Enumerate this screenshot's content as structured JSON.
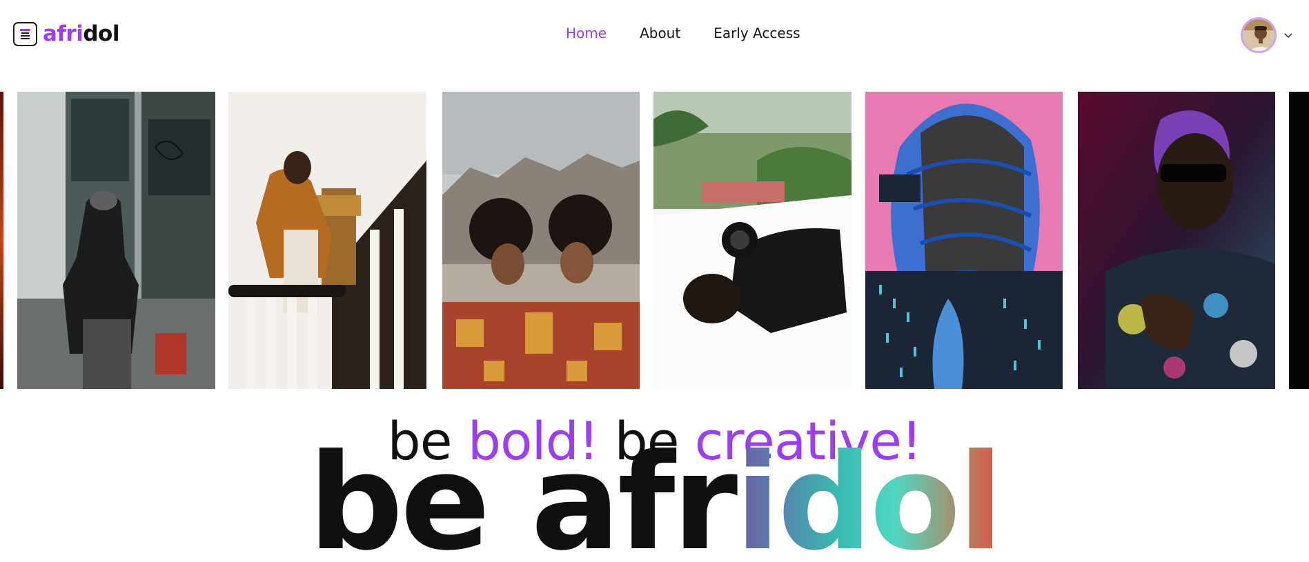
{
  "brand": {
    "name_part1": "afri",
    "name_part2": "dol",
    "accent_color": "#9b3ef2",
    "logo_icon": "book-stack-icon"
  },
  "nav": {
    "items": [
      {
        "label": "Home",
        "active": true
      },
      {
        "label": "About",
        "active": false
      },
      {
        "label": "Early Access",
        "active": false
      }
    ]
  },
  "account": {
    "avatar_icon": "user-avatar",
    "menu_icon": "chevron-down-icon"
  },
  "gallery": {
    "photos": [
      {
        "name": "photo-red-edge"
      },
      {
        "name": "photo-hoodie-graffiti"
      },
      {
        "name": "photo-staircase-jacket"
      },
      {
        "name": "photo-twins-blanket"
      },
      {
        "name": "photo-lying-white"
      },
      {
        "name": "photo-painted-portrait"
      },
      {
        "name": "photo-neon-portrait"
      },
      {
        "name": "photo-dark-edge"
      }
    ]
  },
  "hero": {
    "tagline_be1": "be ",
    "tagline_bold": "bold!",
    "tagline_be2": " be ",
    "tagline_creative": "creative!",
    "headline_plain": "be afr",
    "headline_gradient": "idol"
  }
}
